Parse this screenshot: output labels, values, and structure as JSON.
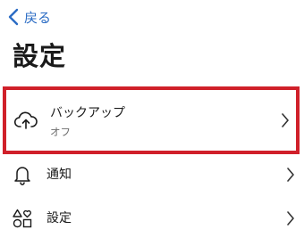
{
  "nav": {
    "back_label": "戻る",
    "back_icon": "chevron-left-icon",
    "accent_color": "#2b6cc4"
  },
  "header": {
    "title": "設定"
  },
  "rows": [
    {
      "label": "バックアップ",
      "sublabel": "オフ",
      "icon": "cloud-upload-icon",
      "highlighted": true,
      "highlight_color": "#d0202a"
    },
    {
      "label": "通知",
      "icon": "bell-icon"
    },
    {
      "label": "設定",
      "icon": "shapes-icon"
    }
  ]
}
